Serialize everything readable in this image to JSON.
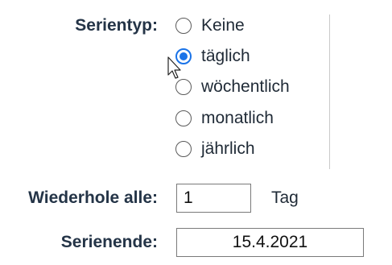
{
  "recurrence": {
    "type_label": "Serientyp:",
    "options": [
      {
        "label": "Keine",
        "checked": false
      },
      {
        "label": "täglich",
        "checked": true
      },
      {
        "label": "wöchentlich",
        "checked": false
      },
      {
        "label": "monatlich",
        "checked": false
      },
      {
        "label": "jährlich",
        "checked": false
      }
    ],
    "repeat_label": "Wiederhole alle:",
    "repeat_value": "1",
    "repeat_unit": "Tag",
    "end_label": "Serienende:",
    "end_value": "15.4.2021"
  },
  "colors": {
    "accent": "#1a73e8",
    "label_text": "#243447"
  },
  "icons": {
    "pointer": "mouse-pointer-icon"
  }
}
